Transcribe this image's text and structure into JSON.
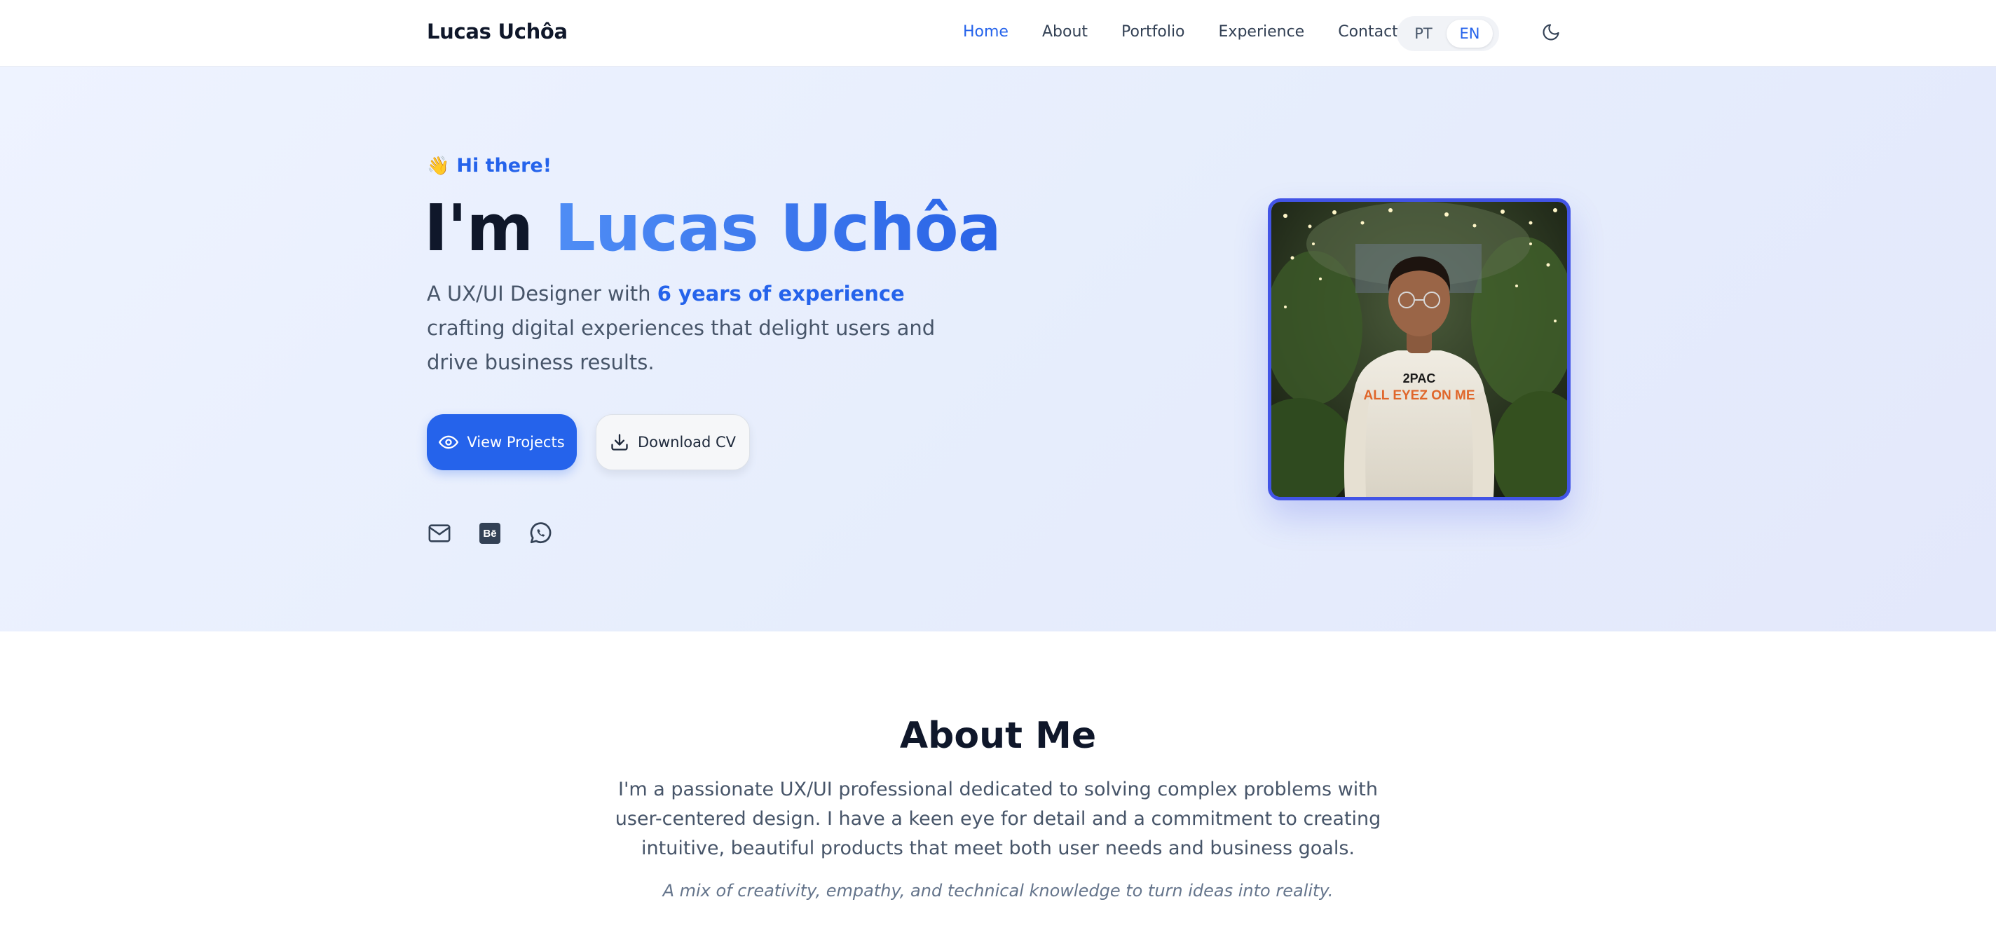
{
  "nav": {
    "brand": "Lucas Uchôa",
    "items": [
      {
        "label": "Home",
        "active": true
      },
      {
        "label": "About",
        "active": false
      },
      {
        "label": "Portfolio",
        "active": false
      },
      {
        "label": "Experience",
        "active": false
      },
      {
        "label": "Contact",
        "active": false
      }
    ],
    "languages": [
      {
        "label": "PT",
        "selected": false
      },
      {
        "label": "EN",
        "selected": true
      }
    ],
    "theme_icon": "moon-icon"
  },
  "hero": {
    "greeting_emoji": "👋",
    "greeting": "Hi there!",
    "headline_prefix": "I'm ",
    "headline_name": "Lucas Uchôa",
    "lead_before": "A UX/UI Designer with ",
    "lead_highlight": "6 years of experience",
    "lead_after": " crafting digital experiences that delight users and drive business results.",
    "primary_button": "View Projects",
    "primary_button_icon": "eye-icon",
    "secondary_button": "Download CV",
    "secondary_button_icon": "download-icon",
    "socials": [
      {
        "icon": "mail-icon"
      },
      {
        "icon": "behance-icon",
        "glyph": "Bē"
      },
      {
        "icon": "whatsapp-icon"
      }
    ],
    "photo": {
      "shirt_text_top": "2PAC",
      "shirt_text_bottom": "ALL EYEZ ON ME"
    }
  },
  "about": {
    "title": "About Me",
    "text": "I'm a passionate UX/UI professional dedicated to solving complex problems with user-centered design. I have a keen eye for detail and a commitment to creating intuitive, beautiful products that meet both user needs and business goals.",
    "quote": "A mix of creativity, empathy, and technical knowledge to turn ideas into reality."
  },
  "colors": {
    "accent": "#2563eb",
    "photo_border": "#4254e6",
    "hero_bg": "#e8eefc",
    "text_dark": "#0f172a",
    "text_muted": "#475569"
  }
}
